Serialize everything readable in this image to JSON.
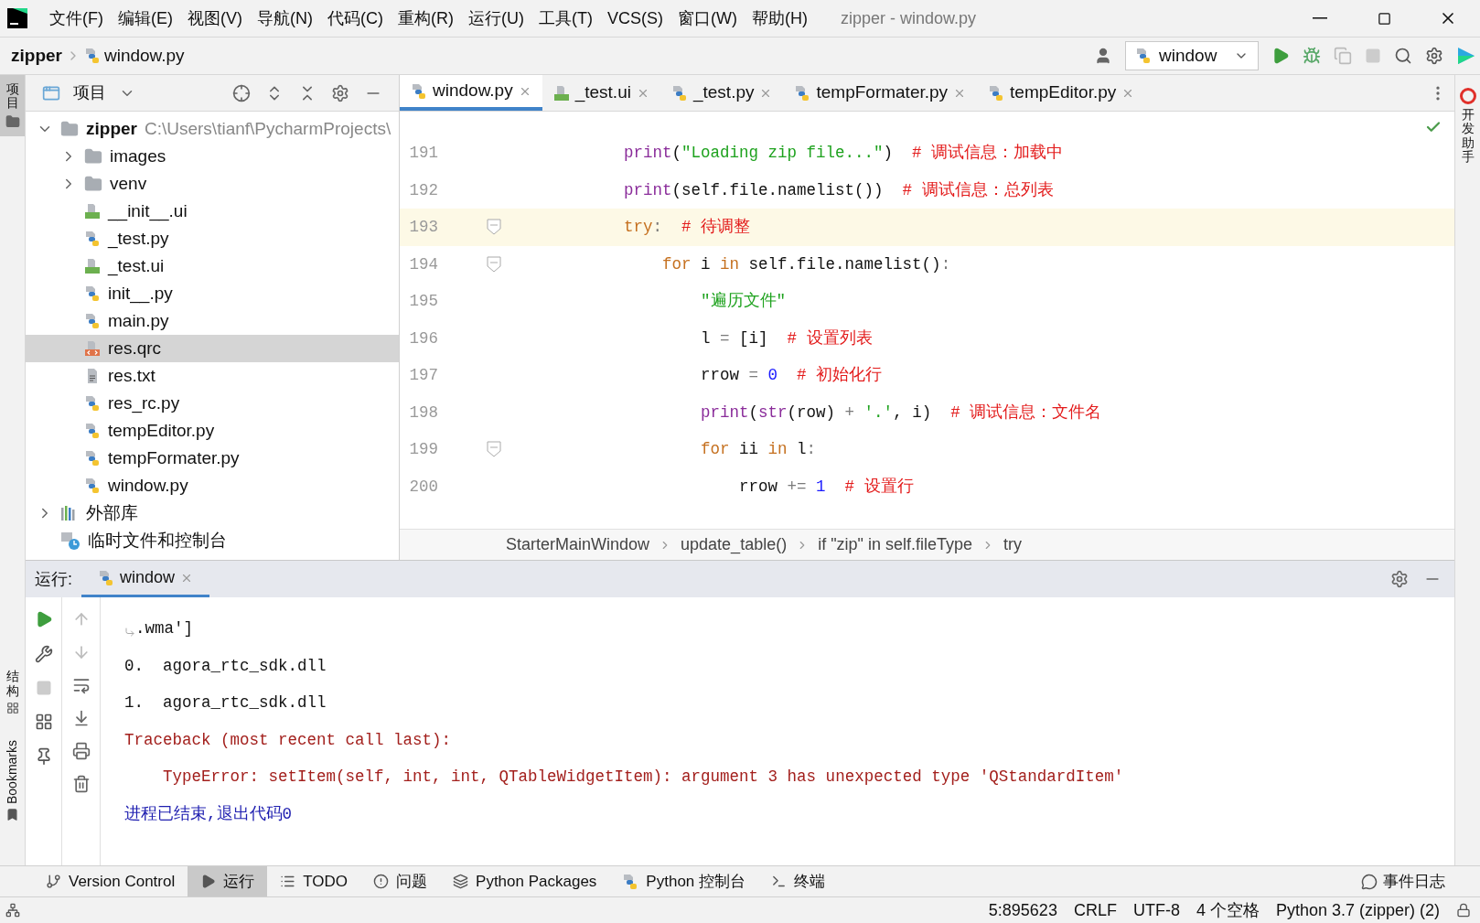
{
  "title_bar": {
    "menus": [
      "文件(F)",
      "编辑(E)",
      "视图(V)",
      "导航(N)",
      "代码(C)",
      "重构(R)",
      "运行(U)",
      "工具(T)",
      "VCS(S)",
      "窗口(W)",
      "帮助(H)"
    ],
    "title": "zipper - window.py"
  },
  "nav_bar": {
    "breadcrumbs": [
      "zipper",
      "window.py"
    ],
    "run_config": "window"
  },
  "left_stripe": {
    "top": [
      {
        "label": "项目",
        "selected": true
      }
    ],
    "bottom": [
      {
        "label": "结构",
        "kind": "cjk"
      },
      {
        "label": "Bookmarks",
        "kind": "latin"
      }
    ]
  },
  "project_panel": {
    "title": "项目",
    "tree": [
      {
        "label": "zipper",
        "path": "C:\\Users\\tianf\\PycharmProjects\\",
        "kind": "folder",
        "expanded": true,
        "selected": false,
        "children": [
          {
            "label": "images",
            "kind": "folder",
            "expanded": false,
            "selected": false
          },
          {
            "label": "venv",
            "kind": "folder",
            "expanded": false,
            "selected": false
          },
          {
            "label": "__init__.ui",
            "kind": "qt",
            "selected": false
          },
          {
            "label": "_test.py",
            "kind": "python",
            "selected": false
          },
          {
            "label": "_test.ui",
            "kind": "qt",
            "selected": false
          },
          {
            "label": "init__.py",
            "kind": "python",
            "selected": false
          },
          {
            "label": "main.py",
            "kind": "python",
            "selected": false
          },
          {
            "label": "res.qrc",
            "kind": "qrc",
            "selected": true
          },
          {
            "label": "res.txt",
            "kind": "text",
            "selected": false
          },
          {
            "label": "res_rc.py",
            "kind": "python",
            "selected": false
          },
          {
            "label": "tempEditor.py",
            "kind": "python",
            "selected": false
          },
          {
            "label": "tempFormater.py",
            "kind": "python",
            "selected": false
          },
          {
            "label": "window.py",
            "kind": "python",
            "selected": false
          }
        ]
      },
      {
        "label": "外部库",
        "kind": "library",
        "expanded": false,
        "selected": false
      },
      {
        "label": "临时文件和控制台",
        "kind": "scratch",
        "selected": false
      }
    ]
  },
  "editor_tabs": [
    {
      "label": "window.py",
      "kind": "python",
      "selected": true
    },
    {
      "label": "_test.ui",
      "kind": "qt",
      "selected": false
    },
    {
      "label": "_test.py",
      "kind": "python",
      "selected": false
    },
    {
      "label": "tempFormater.py",
      "kind": "python",
      "selected": false
    },
    {
      "label": "tempEditor.py",
      "kind": "python",
      "selected": false
    }
  ],
  "editor": {
    "lines": [
      {
        "number": "191",
        "fold": false,
        "current": false,
        "tokens": [
          {
            "kind": "builtin",
            "text": "            print"
          },
          {
            "kind": "plain",
            "text": "("
          },
          {
            "kind": "string",
            "text": "\"Loading zip file...\""
          },
          {
            "kind": "plain",
            "text": ")  "
          },
          {
            "kind": "comment",
            "text": "# 调试信息：加载中"
          }
        ]
      },
      {
        "number": "192",
        "fold": false,
        "current": false,
        "tokens": [
          {
            "kind": "builtin",
            "text": "            print"
          },
          {
            "kind": "plain",
            "text": "(self.file.namelist())  "
          },
          {
            "kind": "comment",
            "text": "# 调试信息：总列表"
          }
        ]
      },
      {
        "number": "193",
        "fold": true,
        "current": true,
        "tokens": [
          {
            "kind": "keyword",
            "text": "            try"
          },
          {
            "kind": "operator",
            "text": ":  "
          },
          {
            "kind": "comment",
            "text": "# 待调整"
          }
        ]
      },
      {
        "number": "194",
        "fold": true,
        "current": false,
        "tokens": [
          {
            "kind": "keyword",
            "text": "                for"
          },
          {
            "kind": "plain",
            "text": " i "
          },
          {
            "kind": "keyword",
            "text": "in"
          },
          {
            "kind": "plain",
            "text": " self.file.namelist()"
          },
          {
            "kind": "operator",
            "text": ":"
          }
        ]
      },
      {
        "number": "195",
        "fold": false,
        "current": false,
        "tokens": [
          {
            "kind": "string",
            "text": "                    \"遍历文件\""
          }
        ]
      },
      {
        "number": "196",
        "fold": false,
        "current": false,
        "tokens": [
          {
            "kind": "plain",
            "text": "                    l "
          },
          {
            "kind": "operator",
            "text": "="
          },
          {
            "kind": "plain",
            "text": " [i]  "
          },
          {
            "kind": "comment",
            "text": "# 设置列表"
          }
        ]
      },
      {
        "number": "197",
        "fold": false,
        "current": false,
        "tokens": [
          {
            "kind": "plain",
            "text": "                    rrow "
          },
          {
            "kind": "operator",
            "text": "= "
          },
          {
            "kind": "number",
            "text": "0  "
          },
          {
            "kind": "comment",
            "text": "# 初始化行"
          }
        ]
      },
      {
        "number": "198",
        "fold": false,
        "current": false,
        "tokens": [
          {
            "kind": "builtin",
            "text": "                    print"
          },
          {
            "kind": "plain",
            "text": "("
          },
          {
            "kind": "builtin",
            "text": "str"
          },
          {
            "kind": "plain",
            "text": "(row) "
          },
          {
            "kind": "operator",
            "text": "+ "
          },
          {
            "kind": "string",
            "text": "'.'"
          },
          {
            "kind": "plain",
            "text": ", i)  "
          },
          {
            "kind": "comment",
            "text": "# 调试信息：文件名"
          }
        ]
      },
      {
        "number": "199",
        "fold": true,
        "current": false,
        "tokens": [
          {
            "kind": "keyword",
            "text": "                    for"
          },
          {
            "kind": "plain",
            "text": " ii "
          },
          {
            "kind": "keyword",
            "text": "in"
          },
          {
            "kind": "plain",
            "text": " l"
          },
          {
            "kind": "operator",
            "text": ":"
          }
        ]
      },
      {
        "number": "200",
        "fold": false,
        "current": false,
        "tokens": [
          {
            "kind": "plain",
            "text": "                        rrow "
          },
          {
            "kind": "operator",
            "text": "+= "
          },
          {
            "kind": "number",
            "text": "1  "
          },
          {
            "kind": "comment",
            "text": "# 设置行"
          }
        ]
      }
    ]
  },
  "breadcrumbs": [
    "StarterMainWindow",
    "update_table()",
    "if \"zip\" in self.fileType",
    "try"
  ],
  "right_stripe": "开发助手",
  "run_panel": {
    "label": "运行:",
    "tab": "window",
    "output": [
      {
        "kind": "wrapped",
        "text": ".wma']"
      },
      {
        "kind": "stdout",
        "text": "0.  agora_rtc_sdk.dll"
      },
      {
        "kind": "stdout",
        "text": "1.  agora_rtc_sdk.dll"
      },
      {
        "kind": "error",
        "text": "Traceback (most recent call last):"
      },
      {
        "kind": "error",
        "text": "    TypeError: setItem(self, int, int, QTableWidgetItem): argument 3 has unexpected type 'QStandardItem'"
      },
      {
        "kind": "exit",
        "text": "进程已结束,退出代码0"
      }
    ]
  },
  "tool_bar": {
    "items": [
      {
        "label": "Version Control",
        "kind": "vcs",
        "selected": false
      },
      {
        "label": "运行",
        "kind": "run",
        "selected": true
      },
      {
        "label": "TODO",
        "kind": "todo",
        "selected": false
      },
      {
        "label": "问题",
        "kind": "problems",
        "selected": false
      },
      {
        "label": "Python Packages",
        "kind": "packages",
        "selected": false
      },
      {
        "label": "Python 控制台",
        "kind": "console",
        "selected": false
      },
      {
        "label": "终端",
        "kind": "terminal",
        "selected": false
      }
    ],
    "event_log": "事件日志"
  },
  "status_bar": [
    "5:895623",
    "CRLF",
    "UTF-8",
    "4 个空格",
    "Python 3.7 (zipper) (2)"
  ]
}
